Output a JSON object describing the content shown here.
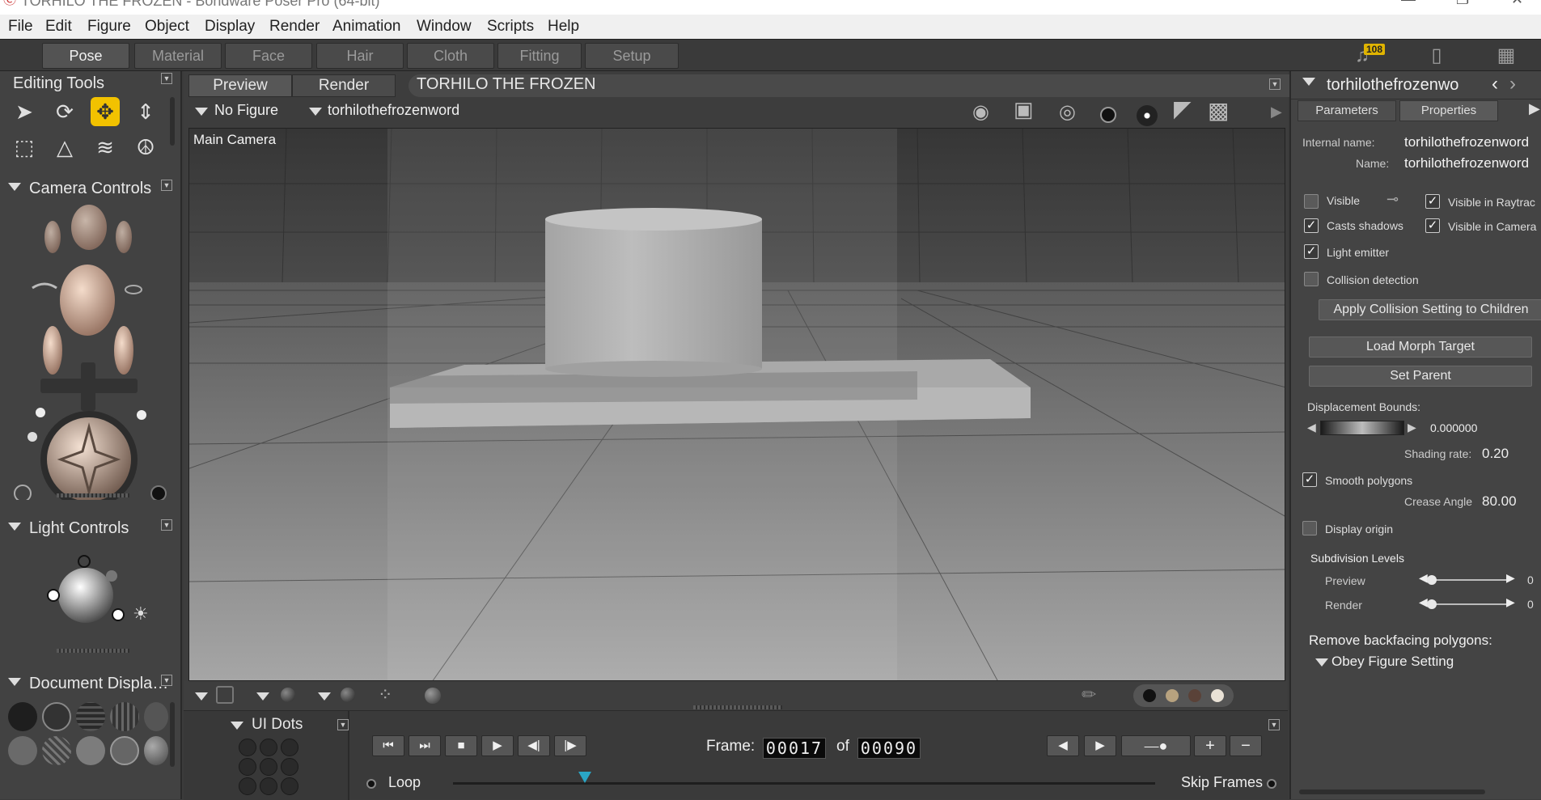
{
  "window": {
    "title": "TORHILO THE FROZEN - Bondware Poser Pro  (64-bit)"
  },
  "menu": [
    "File",
    "Edit",
    "Figure",
    "Object",
    "Display",
    "Render",
    "Animation",
    "Window",
    "Scripts",
    "Help"
  ],
  "rooms": {
    "tabs": [
      "Pose",
      "Material",
      "Face",
      "Hair",
      "Cloth",
      "Fitting",
      "Setup"
    ],
    "active": "Pose",
    "notifications": "108"
  },
  "editing_tools": {
    "title": "Editing Tools"
  },
  "camera_controls": {
    "title": "Camera Controls"
  },
  "light_controls": {
    "title": "Light Controls"
  },
  "document_display": {
    "title": "Document  Displa…"
  },
  "ui_dots": {
    "title": "UI Dots"
  },
  "document": {
    "tabs": [
      "Preview",
      "Render"
    ],
    "scene_title": "TORHILO THE FROZEN",
    "figure_select": "No Figure",
    "actor_select": "torhilothefrozenword",
    "camera_label": "Main Camera"
  },
  "animation": {
    "frame_label": "Frame:",
    "frame": "00017",
    "of_label": "of",
    "total": "00090",
    "loop_label": "Loop",
    "skip_label": "Skip Frames",
    "progress": 0.188
  },
  "properties": {
    "header": "torhilothefrozenwo",
    "tabs": [
      "Parameters",
      "Properties"
    ],
    "active_tab": "Properties",
    "internal_name_label": "Internal name:",
    "internal_name": "torhilothefrozenword",
    "name_label": "Name:",
    "name": "torhilothefrozenword",
    "visible": {
      "label": "Visible",
      "checked": false
    },
    "visible_raytrace": {
      "label": "Visible in Raytrac",
      "checked": true
    },
    "casts_shadows": {
      "label": "Casts shadows",
      "checked": true
    },
    "visible_camera": {
      "label": "Visible in Camera",
      "checked": true
    },
    "light_emitter": {
      "label": "Light emitter",
      "checked": true
    },
    "collision_detection": {
      "label": "Collision detection",
      "checked": false
    },
    "apply_collision": "Apply Collision Setting to Children",
    "load_morph": "Load Morph Target",
    "set_parent": "Set Parent",
    "displacement_label": "Displacement Bounds:",
    "displacement_value": "0.000000",
    "shading_label": "Shading rate:",
    "shading_value": "0.20",
    "smooth_polygons": {
      "label": "Smooth polygons",
      "checked": true
    },
    "crease_label": "Crease Angle",
    "crease_value": "80.00",
    "display_origin": {
      "label": "Display origin",
      "checked": false
    },
    "subdivision_label": "Subdivision Levels",
    "subdiv_preview_label": "Preview",
    "subdiv_preview_value": "0",
    "subdiv_render_label": "Render",
    "subdiv_render_value": "0",
    "backfacing_label": "Remove backfacing polygons:",
    "backfacing_value": "Obey Figure Setting"
  },
  "colors": {
    "accent": "#f2c200",
    "timeline_marker": "#2aa6c6"
  }
}
